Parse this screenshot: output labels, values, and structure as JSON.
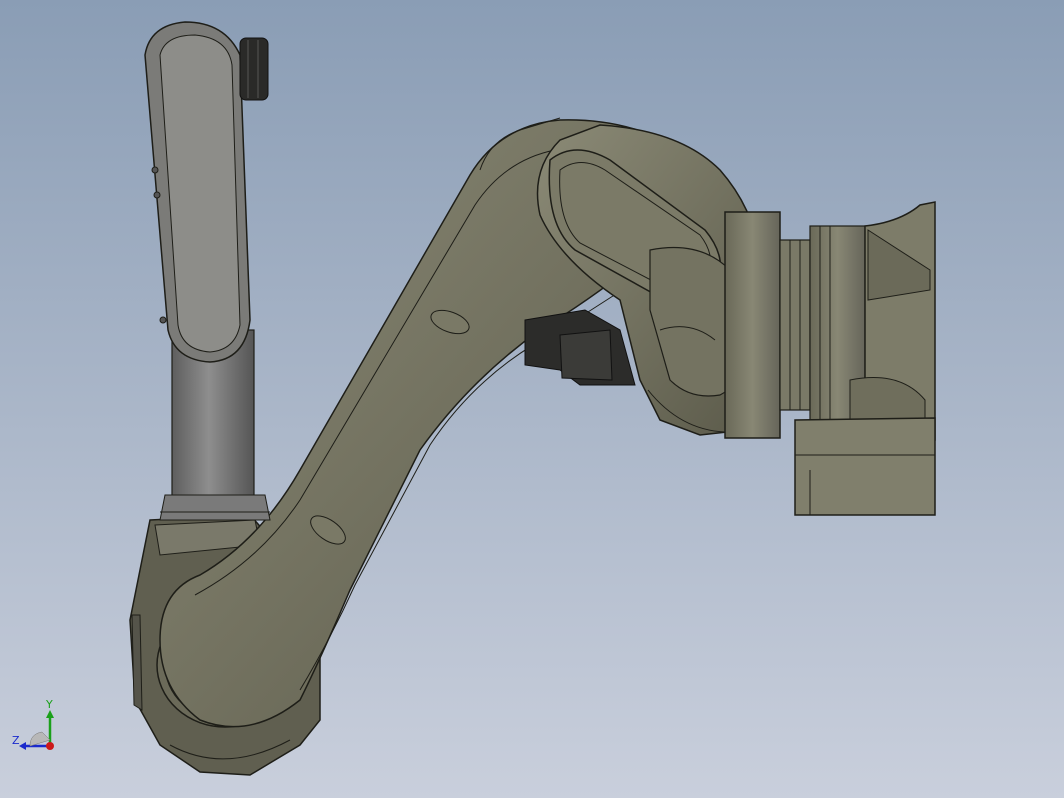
{
  "viewport": {
    "model_name": "industrial-robot-arm",
    "colors": {
      "bg_top": "#8a9db5",
      "bg_bottom": "#c9cfdc",
      "body_main": "#6f6e5e",
      "body_light": "#8a8975",
      "body_dark": "#4f4e42",
      "edge": "#1e1e18",
      "dark_part": "#2c2c2a"
    }
  },
  "triad": {
    "y_label": "Y",
    "z_label": "Z",
    "colors": {
      "y": "#1aa01a",
      "z": "#1a2acc",
      "x": "#cc1a1a"
    }
  }
}
